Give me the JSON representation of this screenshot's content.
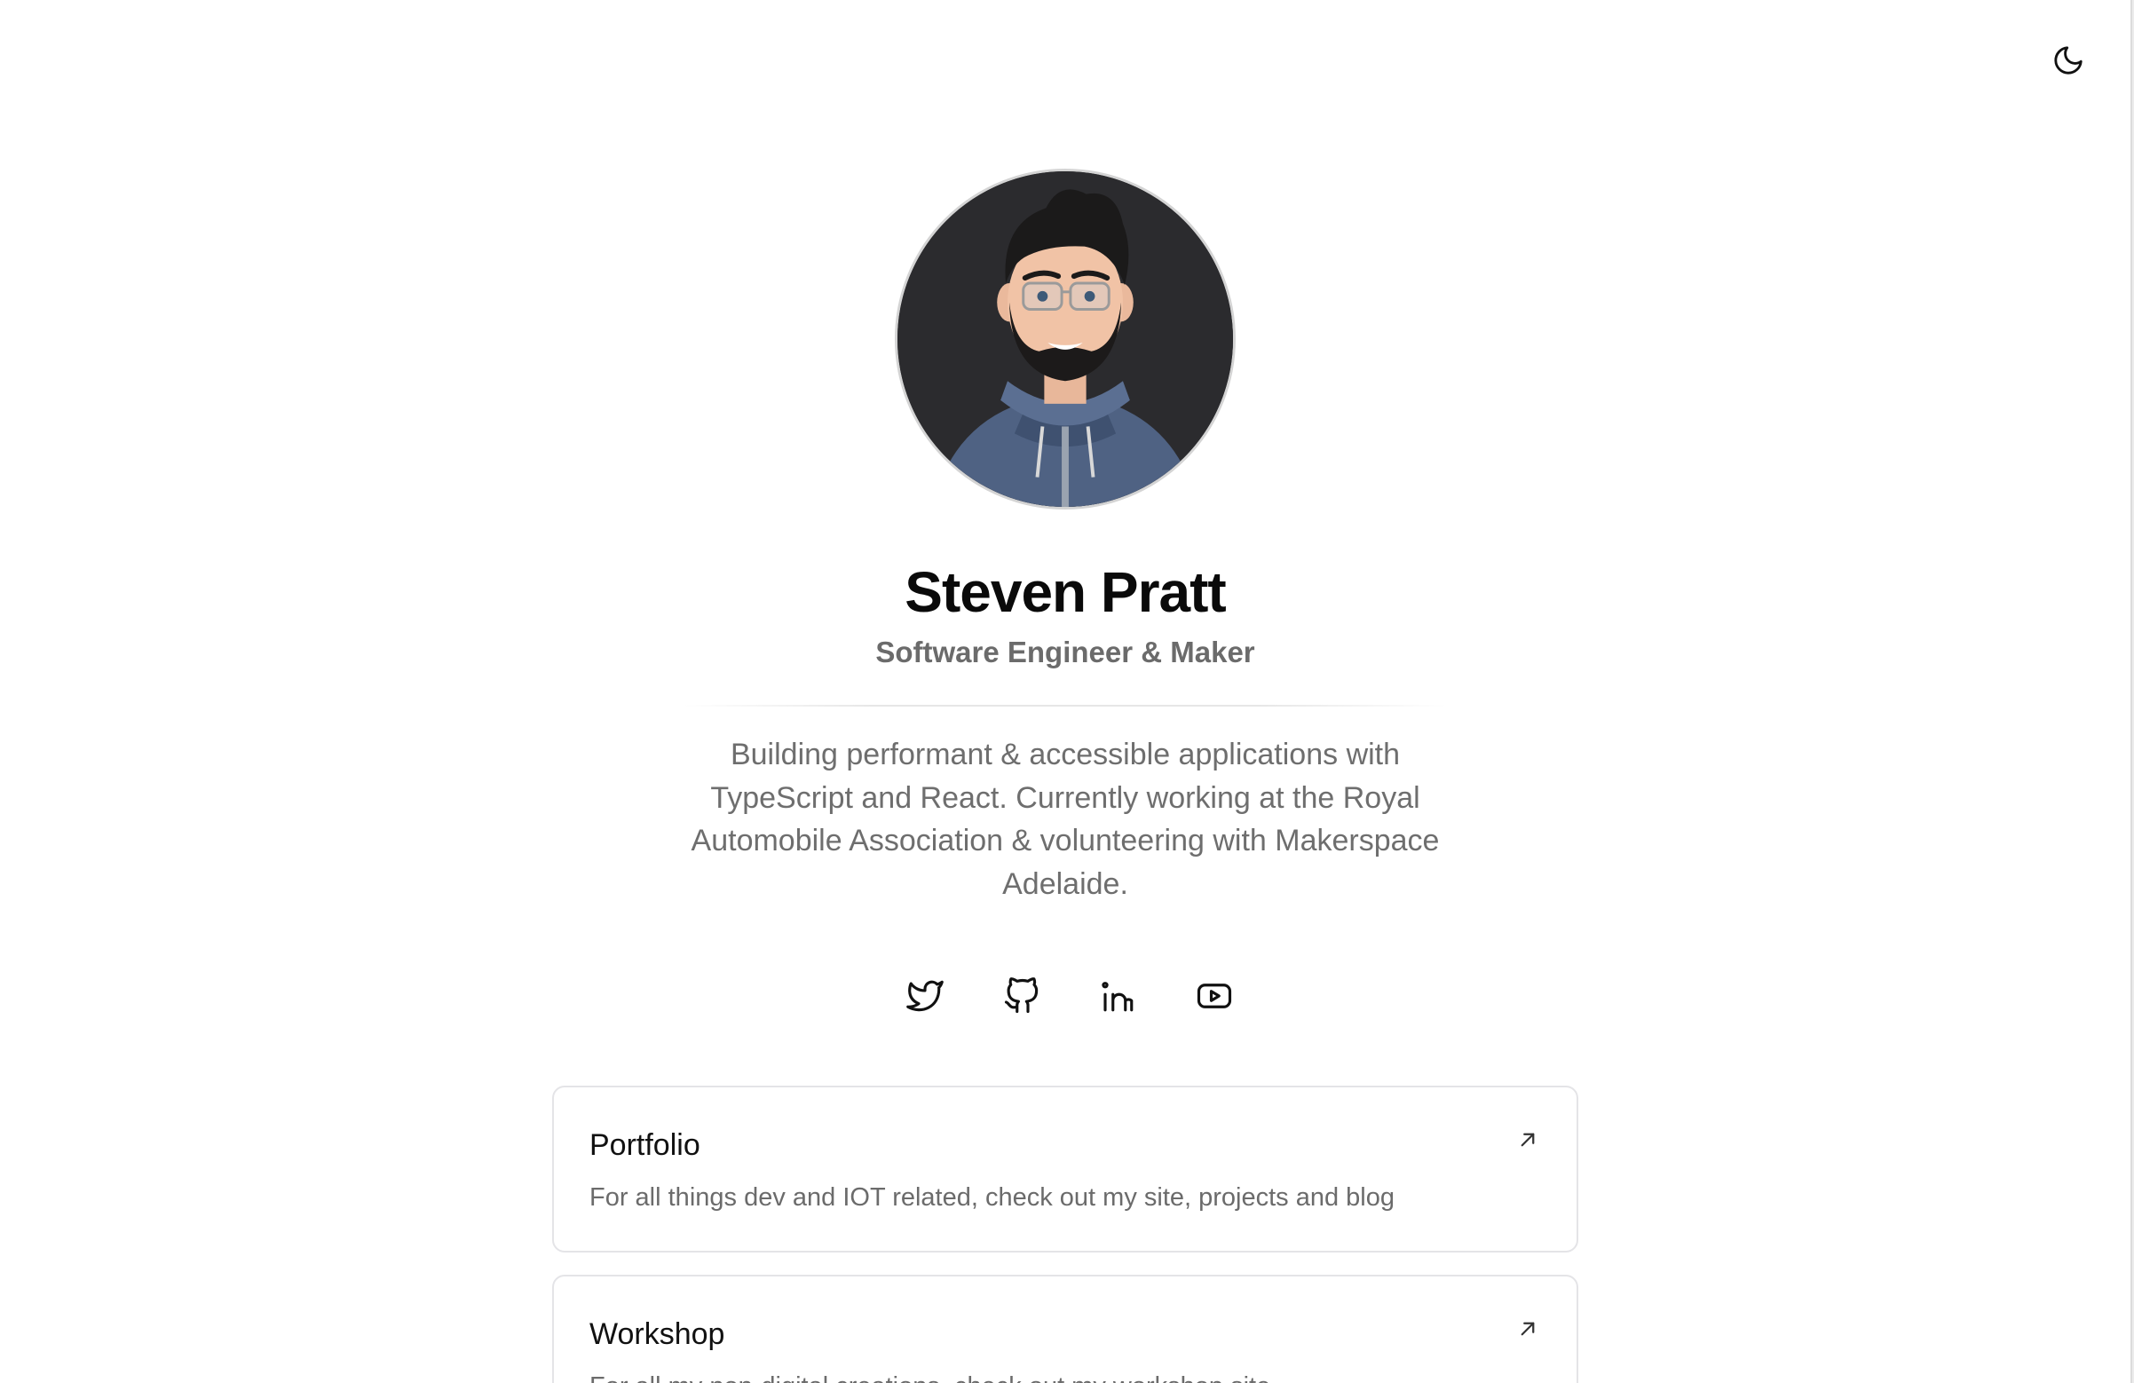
{
  "profile": {
    "name": "Steven Pratt",
    "tagline": "Software Engineer & Maker",
    "bio": "Building performant & accessible applications with TypeScript and React. Currently working at the Royal Automobile Association & volunteering with Makerspace Adelaide."
  },
  "header": {
    "theme_toggle_icon": "moon-icon"
  },
  "socials": [
    {
      "icon": "twitter-icon"
    },
    {
      "icon": "github-icon"
    },
    {
      "icon": "linkedin-icon"
    },
    {
      "icon": "youtube-icon"
    }
  ],
  "links": [
    {
      "title": "Portfolio",
      "description": "For all things dev and IOT related, check out my site, projects and blog",
      "icon": "arrow-up-right-icon"
    },
    {
      "title": "Workshop",
      "description": "For all my non-digital creations, check out my workshop site",
      "icon": "arrow-up-right-icon"
    }
  ],
  "colors": {
    "background": "#ffffff",
    "text": "#0a0a0a",
    "muted": "#6b6b6b",
    "border": "#e4e4e7"
  }
}
